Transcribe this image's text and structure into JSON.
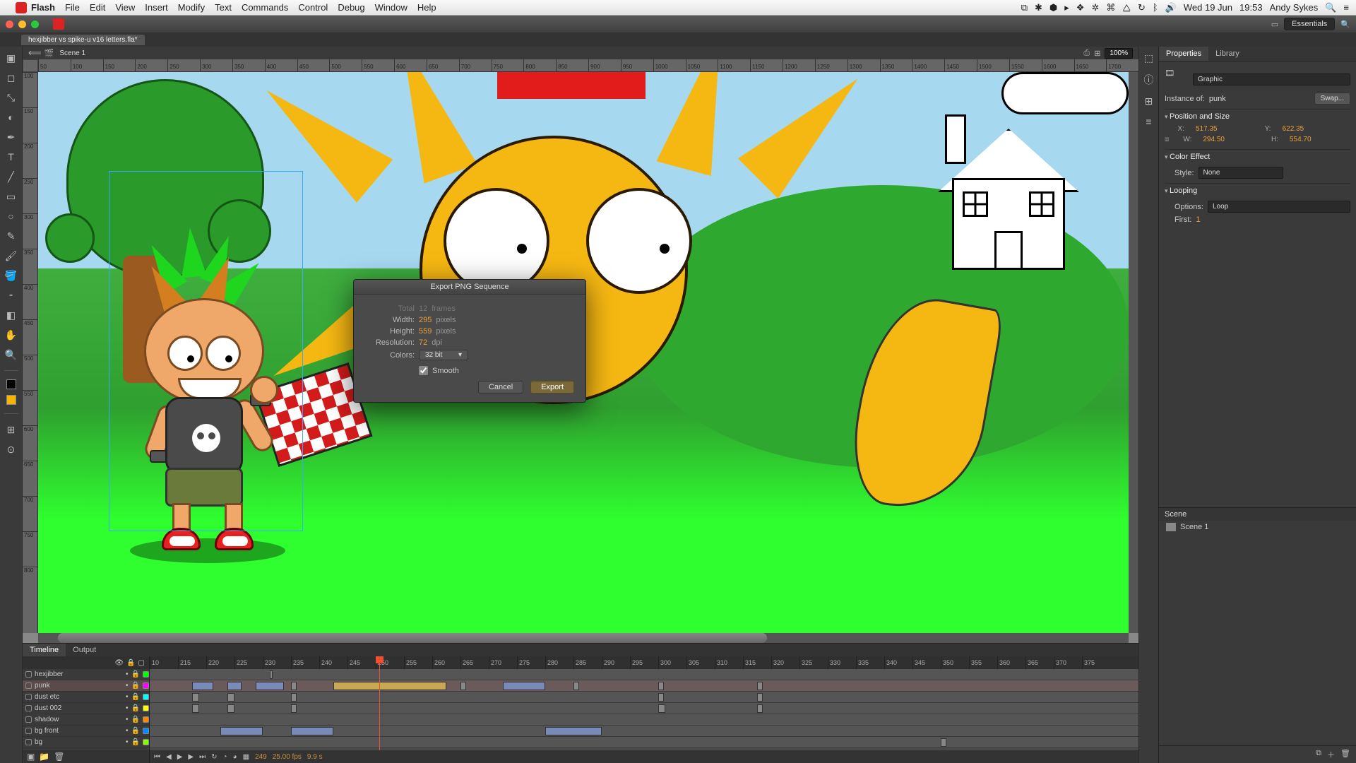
{
  "menubar": {
    "app_name": "Flash",
    "items": [
      "File",
      "Edit",
      "View",
      "Insert",
      "Modify",
      "Text",
      "Commands",
      "Control",
      "Debug",
      "Window",
      "Help"
    ],
    "date": "Wed 19 Jun",
    "time": "19:53",
    "user": "Andy Sykes"
  },
  "workspace": {
    "label": "Essentials"
  },
  "document": {
    "tab": "hexjibber vs spike-u v16 letters.fla*"
  },
  "canvas": {
    "scene_name": "Scene 1",
    "zoom": "100%",
    "ruler_h": [
      "50",
      "100",
      "150",
      "200",
      "250",
      "300",
      "350",
      "400",
      "450",
      "500",
      "550",
      "600",
      "650",
      "700",
      "750",
      "800",
      "850",
      "900",
      "950",
      "1000",
      "1050",
      "1100",
      "1150",
      "1200",
      "1250",
      "1300",
      "1350",
      "1400",
      "1450",
      "1500",
      "1550",
      "1600",
      "1650",
      "1700"
    ],
    "ruler_v": [
      "100",
      "150",
      "200",
      "250",
      "300",
      "350",
      "400",
      "450",
      "500",
      "550",
      "600",
      "650",
      "700",
      "750",
      "800"
    ]
  },
  "properties": {
    "tab_properties": "Properties",
    "tab_library": "Library",
    "type": "Graphic",
    "instance_label": "Instance of:",
    "instance_value": "punk",
    "swap_label": "Swap...",
    "section_pos": "Position and Size",
    "x_label": "X:",
    "x_value": "517.35",
    "y_label": "Y:",
    "y_value": "622.35",
    "w_label": "W:",
    "w_value": "294.50",
    "h_label": "H:",
    "h_value": "554.70",
    "section_color": "Color Effect",
    "style_label": "Style:",
    "style_value": "None",
    "section_loop": "Looping",
    "options_label": "Options:",
    "options_value": "Loop",
    "first_label": "First:",
    "first_value": "1"
  },
  "scene_panel": {
    "header": "Scene",
    "item": "Scene 1"
  },
  "timeline": {
    "tab_timeline": "Timeline",
    "tab_output": "Output",
    "frames": [
      "10",
      "215",
      "220",
      "225",
      "230",
      "235",
      "240",
      "245",
      "250",
      "255",
      "260",
      "265",
      "270",
      "275",
      "280",
      "285",
      "290",
      "295",
      "300",
      "305",
      "310",
      "315",
      "320",
      "325",
      "330",
      "335",
      "340",
      "345",
      "350",
      "355",
      "360",
      "365",
      "370",
      "375"
    ],
    "layers": [
      "hexjibber",
      "punk",
      "dust etc",
      "dust 002",
      "shadow",
      "bg front",
      "bg"
    ],
    "status": {
      "frame": "249",
      "fps": "25.00 fps",
      "time": "9.9 s"
    }
  },
  "modal": {
    "title": "Export PNG Sequence",
    "total_label": "Total",
    "total_value": "12",
    "total_unit": "frames",
    "width_label": "Width:",
    "width_value": "295",
    "height_label": "Height:",
    "height_value": "559",
    "pixels_unit": "pixels",
    "resolution_label": "Resolution:",
    "resolution_value": "72",
    "dpi_unit": "dpi",
    "colors_label": "Colors:",
    "colors_value": "32 bit",
    "smooth_label": "Smooth",
    "cancel": "Cancel",
    "export": "Export"
  }
}
